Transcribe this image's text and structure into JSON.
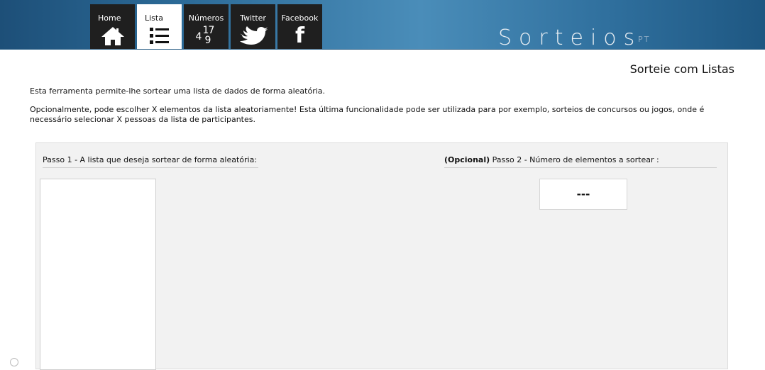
{
  "nav": {
    "tabs": [
      {
        "label": "Home",
        "icon": "home-icon",
        "active": false
      },
      {
        "label": "Lista",
        "icon": "list-icon",
        "active": true
      },
      {
        "label": "Números",
        "icon": "numbers-icon",
        "active": false
      },
      {
        "label": "Twitter",
        "icon": "twitter-bird-icon",
        "active": false
      },
      {
        "label": "Facebook",
        "icon": "facebook-f-icon",
        "active": false
      }
    ],
    "numbers_glyphs": {
      "a": "4",
      "b": "1",
      "c": "7",
      "d": "9"
    },
    "facebook_glyph": "f"
  },
  "brand": {
    "name": "Sorteios",
    "suffix": "PT"
  },
  "page": {
    "heading": "Sorteie com Listas",
    "intro_1": "Esta ferramenta permite-lhe sortear uma lista de dados de forma aleatória.",
    "intro_2": "Opcionalmente, pode escolher X elementos da lista aleatoriamente! Esta última funcionalidade pode ser utilizada para por exemplo, sorteios de concursos ou jogos, onde é necessário selecionar X pessoas da lista de participantes."
  },
  "panel": {
    "step1_title": "Passo 1 - A lista que deseja sortear de forma aleatória:",
    "step2_optional": "(Opcional)",
    "step2_title": " Passo 2 - Número de elementos a sortear :",
    "list_value": "",
    "count_value": "---"
  },
  "colors": {
    "header_dark": "#1d4f78",
    "header_light": "#4a8db9",
    "tab_bg": "#1f1f1f",
    "panel_bg": "#f2f2f2"
  }
}
